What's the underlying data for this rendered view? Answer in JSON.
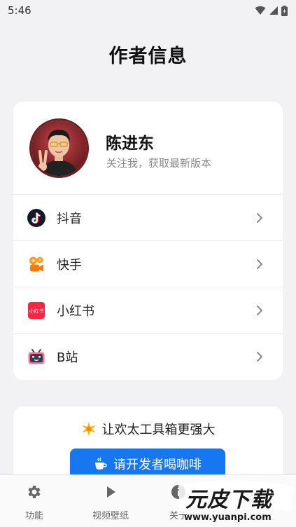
{
  "status_bar": {
    "time": "5:46"
  },
  "page": {
    "title": "作者信息"
  },
  "author": {
    "name": "陈进东",
    "subtitle": "关注我，获取最新版本"
  },
  "links": [
    {
      "label": "抖音",
      "icon": "douyin-icon"
    },
    {
      "label": "快手",
      "icon": "kuaishou-icon"
    },
    {
      "label": "小红书",
      "icon": "xiaohongshu-icon"
    },
    {
      "label": "B站",
      "icon": "bilibili-icon"
    }
  ],
  "xiaohongshu_icon_text": "小红书",
  "support": {
    "title": "让欢太工具箱更强大",
    "button_label": "请开发者喝咖啡"
  },
  "bottom_nav": [
    {
      "label": "功能",
      "icon": "gear-icon"
    },
    {
      "label": "视频壁纸",
      "icon": "play-icon"
    },
    {
      "label": "关于",
      "icon": "info-icon"
    }
  ],
  "watermark": {
    "title": "元皮下载",
    "url": "www.yuanpi.com"
  },
  "colors": {
    "background": "#f2f2f5",
    "card": "#ffffff",
    "accent": "#1677f0"
  }
}
